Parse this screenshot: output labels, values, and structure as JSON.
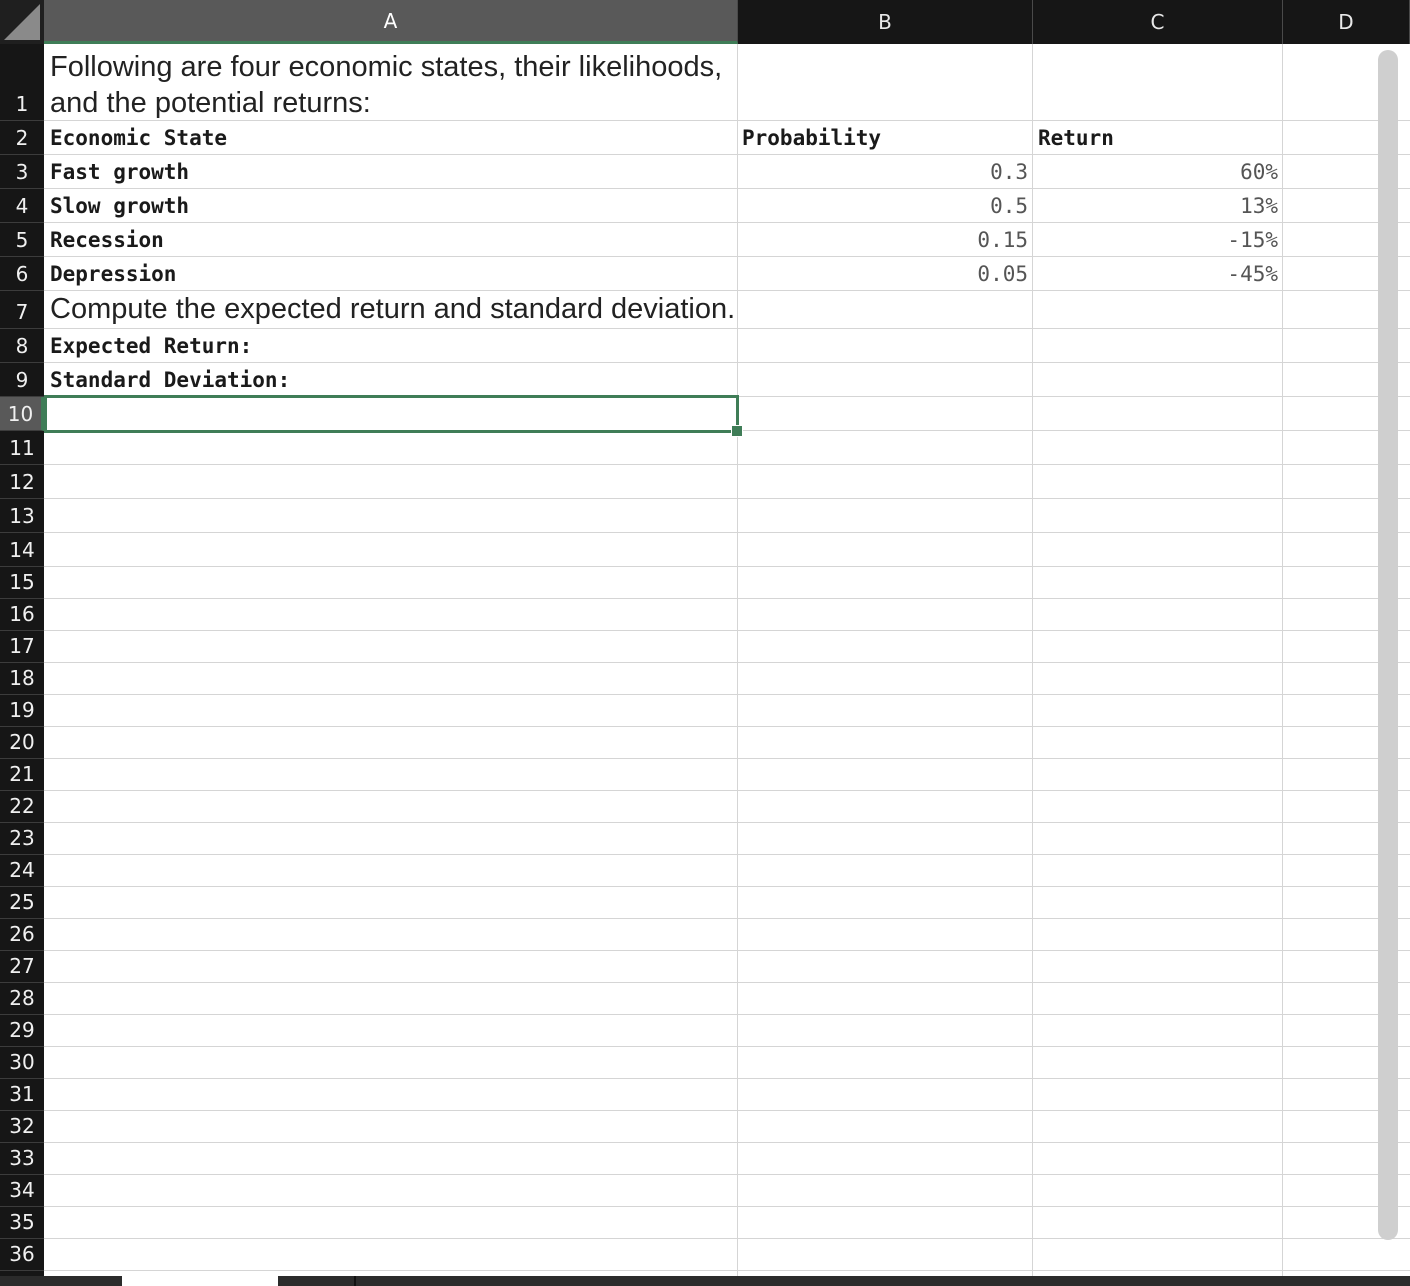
{
  "columns": [
    {
      "label": "A",
      "selected": true
    },
    {
      "label": "B",
      "selected": false
    },
    {
      "label": "C",
      "selected": false
    },
    {
      "label": "D",
      "selected": false
    }
  ],
  "rows": [
    "1",
    "2",
    "3",
    "4",
    "5",
    "6",
    "7",
    "8",
    "9",
    "10",
    "11",
    "12",
    "13",
    "14",
    "15",
    "16",
    "17",
    "18",
    "19",
    "20",
    "21",
    "22",
    "23",
    "24",
    "25",
    "26",
    "27",
    "28",
    "29",
    "30",
    "31",
    "32",
    "33",
    "34",
    "35",
    "36"
  ],
  "selected_row": "10",
  "cells": {
    "a1_line1": "Following are four economic states, their likelihoods,",
    "a1_line2": "and the potential returns:",
    "a2": "Economic State",
    "b2": "Probability",
    "c2": "Return",
    "a3": "Fast growth",
    "b3": "0.3",
    "c3": "60%",
    "a4": "Slow growth",
    "b4": "0.5",
    "c4": "13%",
    "a5": "Recession",
    "b5": "0.15",
    "c5": "-15%",
    "a6": "Depression",
    "b6": "0.05",
    "c6": "-45%",
    "a7": "Compute the expected return and standard deviation.",
    "a8": "Expected Return:",
    "a9": "Standard Deviation:"
  },
  "selected_cell": "A10",
  "colors": {
    "selection": "#3f7d57",
    "header_bg": "#161616",
    "selected_header_bg": "#595959",
    "gridline": "#d5d5d5"
  }
}
